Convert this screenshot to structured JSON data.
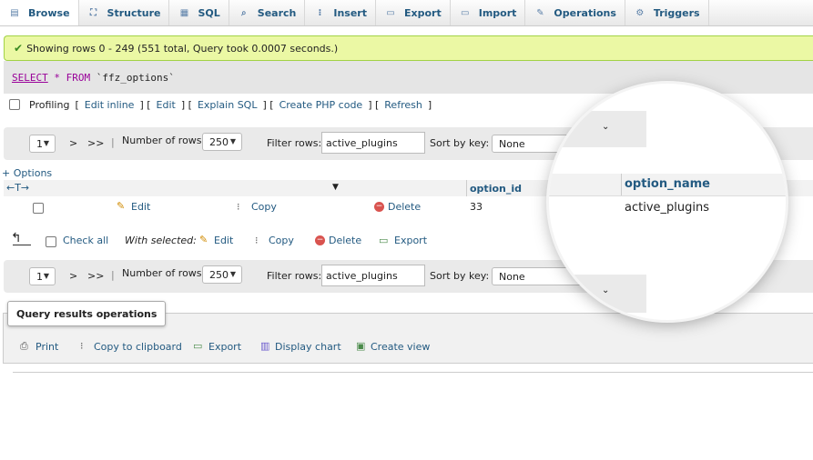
{
  "tabs": [
    {
      "label": "Browse",
      "icon": "browse-icon"
    },
    {
      "label": "Structure",
      "icon": "structure-icon"
    },
    {
      "label": "SQL",
      "icon": "sql-icon"
    },
    {
      "label": "Search",
      "icon": "search-icon"
    },
    {
      "label": "Insert",
      "icon": "insert-icon"
    },
    {
      "label": "Export",
      "icon": "export-icon"
    },
    {
      "label": "Import",
      "icon": "import-icon"
    },
    {
      "label": "Operations",
      "icon": "operations-icon"
    },
    {
      "label": "Triggers",
      "icon": "triggers-icon"
    }
  ],
  "message": "Showing rows 0 - 249 (551 total, Query took 0.0007 seconds.)",
  "sql": {
    "select": "SELECT",
    "star": "*",
    "from": "FROM",
    "table": "`ffz_options`"
  },
  "tools": {
    "profiling": "Profiling",
    "edit_inline": "Edit inline",
    "edit": "Edit",
    "explain": "Explain SQL",
    "php": "Create PHP code",
    "refresh": "Refresh"
  },
  "nav": {
    "page": "1",
    "next": ">",
    "last": ">>",
    "sep": "|",
    "rows_label": "Number of rows:",
    "rows_value": "250",
    "filter_label": "Filter rows:",
    "filter_value": "active_plugins",
    "sort_label": "Sort by key:",
    "sort_value": "None"
  },
  "options_link": "+ Options",
  "columns": {
    "arrows": "←T→",
    "option_id": "option_id",
    "option_name": "option_name"
  },
  "row": {
    "edit": "Edit",
    "copy": "Copy",
    "delete": "Delete",
    "option_id": "33",
    "option_name": "active_plugins"
  },
  "bulk": {
    "check_all": "Check all",
    "with_selected": "With selected:",
    "edit": "Edit",
    "copy": "Copy",
    "delete": "Delete",
    "export": "Export"
  },
  "ops": {
    "legend": "Query results operations",
    "print": "Print",
    "copy_clipboard": "Copy to clipboard",
    "export": "Export",
    "display_chart": "Display chart",
    "create_view": "Create view"
  }
}
